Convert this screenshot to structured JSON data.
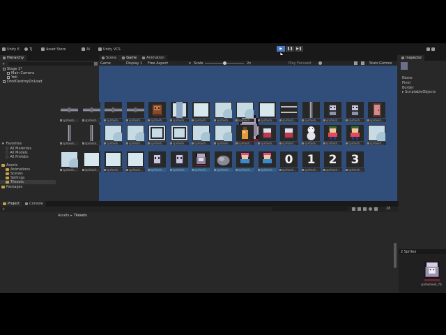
{
  "toolbar": {
    "account": "Unity 6",
    "user": "TJ",
    "asset_store": "Asset Store",
    "ai": "AI",
    "vcs": "Unity VCS",
    "play_icon": "play-icon",
    "pause_icon": "pause-icon",
    "step_icon": "step-icon"
  },
  "hierarchy": {
    "tab": "Hierarchy",
    "items": [
      {
        "label": "Stage 1*",
        "depth": 0
      },
      {
        "label": "Main Camera",
        "depth": 1
      },
      {
        "label": "Yeti",
        "depth": 1
      },
      {
        "label": "DontDestroyOnLoad",
        "depth": 0
      }
    ]
  },
  "center_tabs": {
    "scene": "Scene",
    "game": "Game",
    "animation": "Animation"
  },
  "game_bar": {
    "mode": "Game",
    "display": "Display 1",
    "aspect": "Free Aspect",
    "scale_label": "Scale",
    "scale_value": "2x",
    "play_focused": "Play Focused",
    "stats": "Stats",
    "gizmos": "Gizmos",
    "scale_fraction": 0.5
  },
  "inspector": {
    "tab": "Inspector",
    "rows": [
      "Name",
      "Pivot",
      "Border"
    ],
    "section": "ScriptableObjects"
  },
  "bottom_tabs": {
    "project": "Project",
    "console": "Console"
  },
  "project": {
    "tree": [
      {
        "label": "Favorites",
        "depth": 0,
        "kind": "star"
      },
      {
        "label": "All Materials",
        "depth": 1,
        "kind": "search"
      },
      {
        "label": "All Models",
        "depth": 1,
        "kind": "search"
      },
      {
        "label": "All Prefabs",
        "depth": 1,
        "kind": "search"
      },
      {
        "label": "Assets",
        "depth": 0,
        "kind": "folder"
      },
      {
        "label": "Animations",
        "depth": 1,
        "kind": "folder"
      },
      {
        "label": "Scenes",
        "depth": 1,
        "kind": "folder"
      },
      {
        "label": "Settings",
        "depth": 1,
        "kind": "folder"
      },
      {
        "label": "Tilesets",
        "depth": 1,
        "kind": "folder",
        "selected": true
      },
      {
        "label": "Packages",
        "depth": 0,
        "kind": "folder"
      }
    ],
    "breadcrumb": [
      "Assets",
      "Tilesets"
    ],
    "asset_caption": "spritesh...",
    "hidden_count": "28",
    "rows": [
      [
        "hbar",
        "hbar",
        "hbar",
        "hbar",
        "monkey",
        "lightcol",
        "light",
        "tile",
        "tile",
        "light",
        "lines",
        "vbar",
        "robot",
        "robot",
        "pinkdoor"
      ],
      [
        "vbar",
        "vbar",
        "tile",
        "tile",
        "frame",
        "frame",
        "tile",
        "tile",
        "potion",
        "jar",
        "jar",
        "snowman",
        "kid",
        "kid",
        "tile"
      ],
      [
        "tile",
        "light",
        "light",
        "light",
        "ghost",
        "ghost",
        "yeti",
        "rock",
        "fighter",
        "fighter",
        "0",
        "1",
        "2",
        "3"
      ]
    ],
    "selected_row": 2,
    "selected_from": 4,
    "selected_to": 9
  },
  "preview": {
    "title": "2 Sprites",
    "caption": "spritesheet_76"
  }
}
